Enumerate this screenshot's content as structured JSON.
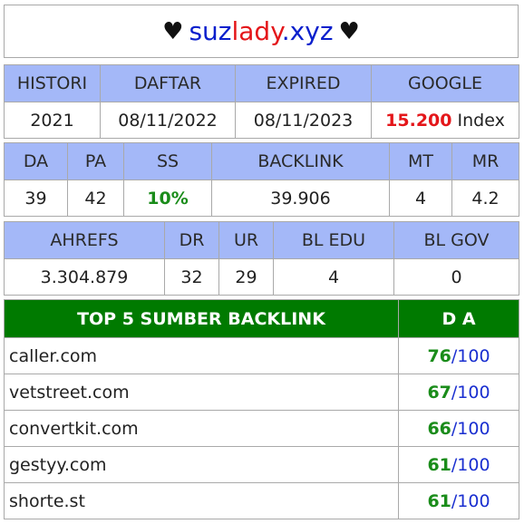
{
  "title": {
    "heart": "♥",
    "site_part1": "suz",
    "site_part2": "lady",
    "site_part3": ".xyz"
  },
  "section1": {
    "headers": [
      "HISTORI",
      "DAFTAR",
      "EXPIRED",
      "GOOGLE"
    ],
    "values": {
      "histori": "2021",
      "daftar": "08/11/2022",
      "expired": "08/11/2023",
      "google_count": "15.200",
      "google_suffix": "Index"
    }
  },
  "section2": {
    "headers": [
      "DA",
      "PA",
      "SS",
      "BACKLINK",
      "MT",
      "MR"
    ],
    "values": [
      "39",
      "42",
      "10%",
      "39.906",
      "4",
      "4.2"
    ]
  },
  "section3": {
    "headers": [
      "AHREFS",
      "DR",
      "UR",
      "BL EDU",
      "BL GOV"
    ],
    "values": [
      "3.304.879",
      "32",
      "29",
      "4",
      "0"
    ]
  },
  "top5": {
    "header_name": "TOP 5 SUMBER BACKLINK",
    "header_da": "D A",
    "da_max": "/100",
    "rows": [
      {
        "domain": "caller.com",
        "da": "76"
      },
      {
        "domain": "vetstreet.com",
        "da": "67"
      },
      {
        "domain": "convertkit.com",
        "da": "66"
      },
      {
        "domain": "gestyy.com",
        "da": "61"
      },
      {
        "domain": "shorte.st",
        "da": "61"
      }
    ]
  },
  "colors": {
    "header_bg": "#a4b8f8",
    "top_header_bg": "#007a00",
    "accent_red": "#e4161a",
    "accent_green": "#1a8c1a",
    "accent_blue": "#1a2fd0"
  }
}
